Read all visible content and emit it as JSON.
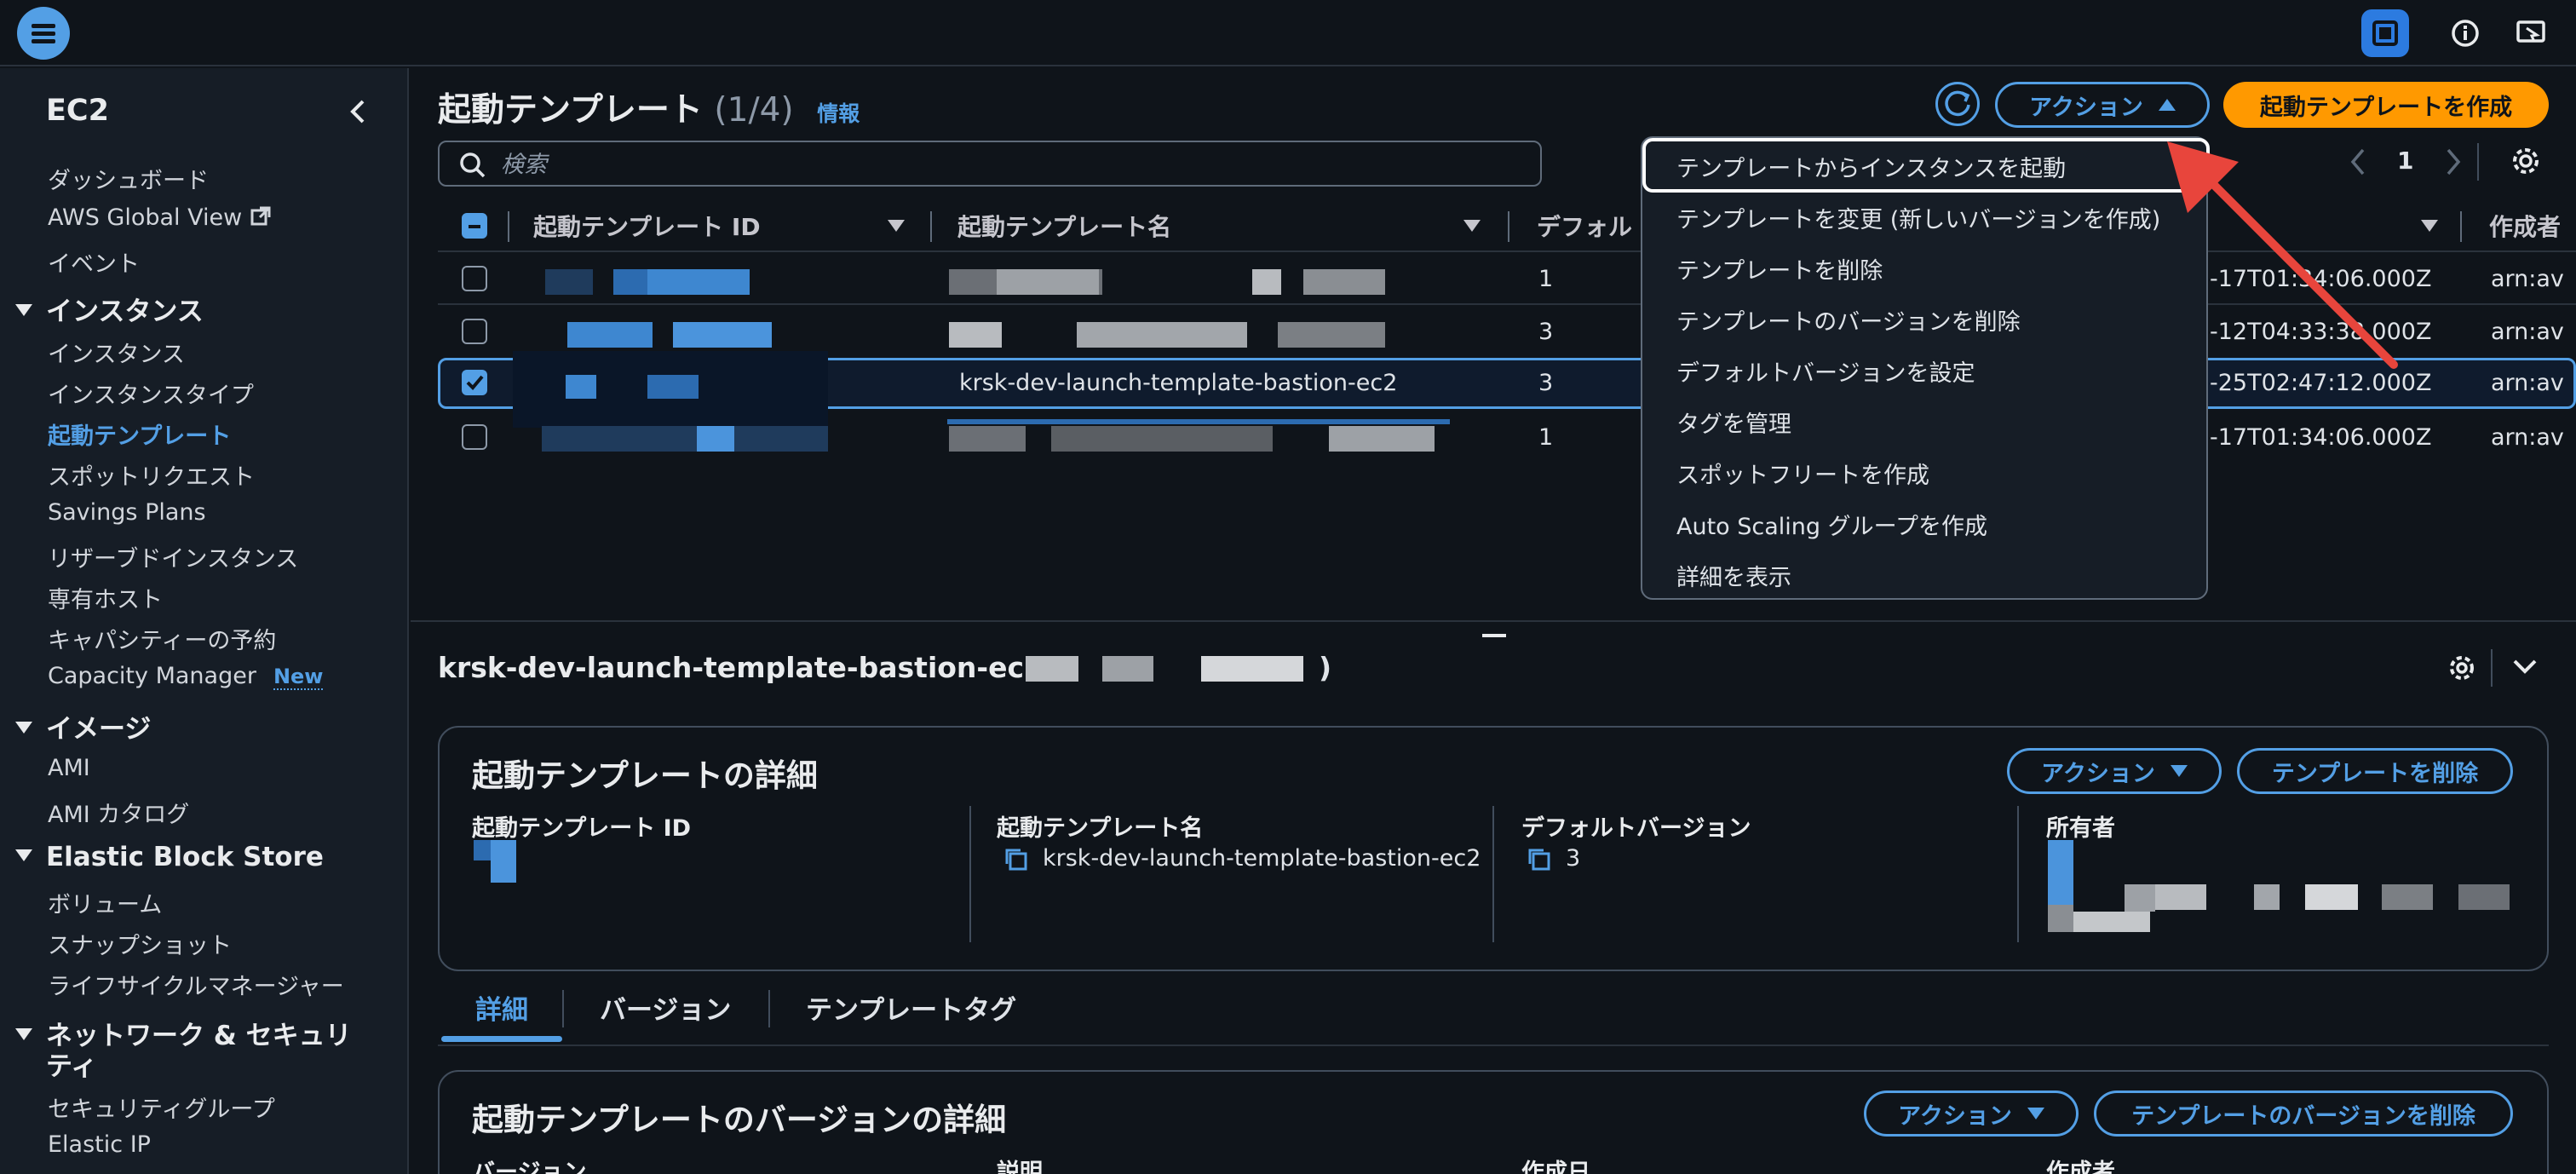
{
  "sidebar": {
    "title": "EC2",
    "items": {
      "dashboard": "ダッシュボード",
      "global_view": "AWS Global View",
      "events": "イベント",
      "sec_instances": "インスタンス",
      "instances": "インスタンス",
      "instance_types": "インスタンスタイプ",
      "launch_templates": "起動テンプレート",
      "spot_requests": "スポットリクエスト",
      "savings_plans": "Savings Plans",
      "reserved": "リザーブドインスタンス",
      "dedicated_hosts": "専有ホスト",
      "capacity_reservations": "キャパシティーの予約",
      "capacity_manager": "Capacity Manager",
      "new_badge": "New",
      "sec_images": "イメージ",
      "ami": "AMI",
      "ami_catalog": "AMI カタログ",
      "sec_ebs": "Elastic Block Store",
      "volumes": "ボリューム",
      "snapshots": "スナップショット",
      "lifecycle": "ライフサイクルマネージャー",
      "sec_network_1": "ネットワーク & セキュリ",
      "sec_network_2": "ティ",
      "security_groups": "セキュリティグループ",
      "elastic_ip": "Elastic IP"
    }
  },
  "header": {
    "title": "起動テンプレート",
    "count": "(1/4)",
    "info": "情報",
    "actions_label": "アクション",
    "create_label": "起動テンプレートを作成",
    "search_placeholder": "検索",
    "page_number": "1"
  },
  "table": {
    "columns": {
      "id": "起動テンプレート ID",
      "name": "起動テンプレート名",
      "default": "デフォル",
      "created": "作成者"
    },
    "rows": [
      {
        "version": "1",
        "time": "-17T01:34:06.000Z",
        "arn": "arn:av"
      },
      {
        "version": "3",
        "time": "-12T04:33:38.000Z",
        "arn": "arn:av"
      },
      {
        "name": "krsk-dev-launch-template-bastion-ec2",
        "version": "3",
        "time": "-25T02:47:12.000Z",
        "arn": "arn:av"
      },
      {
        "version": "1",
        "time": "-17T01:34:06.000Z",
        "arn": "arn:av"
      }
    ]
  },
  "dropdown": {
    "items": [
      "テンプレートからインスタンスを起動",
      "テンプレートを変更 (新しいバージョンを作成)",
      "テンプレートを削除",
      "テンプレートのバージョンを削除",
      "デフォルトバージョンを設定",
      "タグを管理",
      "スポットフリートを作成",
      "Auto Scaling グループを作成",
      "詳細を表示"
    ]
  },
  "detail": {
    "selected_name": "krsk-dev-launch-template-bastion-ec2",
    "paren_open": "(",
    "paren_close": ")",
    "panel_title": "起動テンプレートの詳細",
    "actions_label": "アクション",
    "delete_template": "テンプレートを削除",
    "labels": {
      "id": "起動テンプレート ID",
      "name": "起動テンプレート名",
      "default_version": "デフォルトバージョン",
      "owner": "所有者"
    },
    "values": {
      "name": "krsk-dev-launch-template-bastion-ec2",
      "default_version": "3"
    },
    "tabs": [
      "詳細",
      "バージョン",
      "テンプレートタグ"
    ],
    "version_panel_title": "起動テンプレートのバージョンの詳細",
    "version_actions": "アクション",
    "delete_version": "テンプレートのバージョンを削除",
    "bottom_labels": [
      "バージョン",
      "説明",
      "作成日",
      "作成者"
    ]
  },
  "colors": {
    "accent": "#539fe5",
    "primary": "#ff9900",
    "background": "#0f141a",
    "arrow": "#e8453c"
  }
}
